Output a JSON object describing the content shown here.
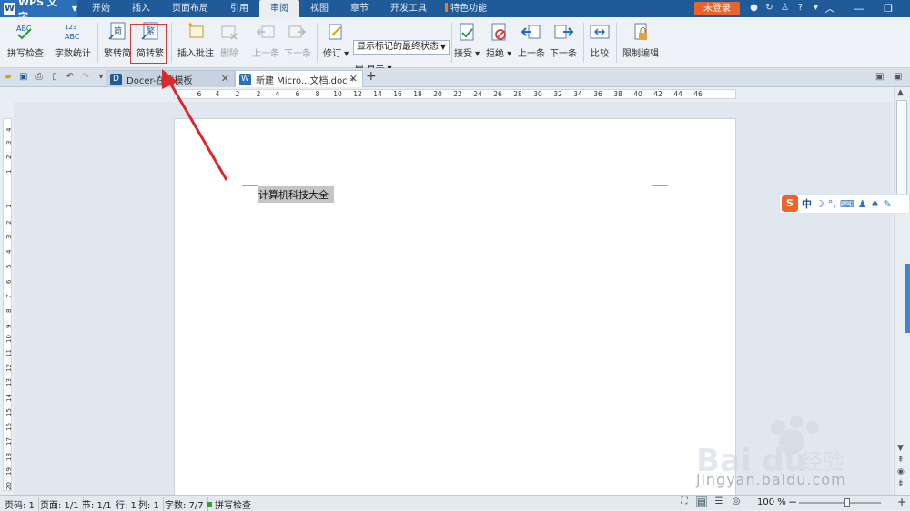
{
  "app": {
    "logo": "WPS 文字",
    "logo_letter": "W"
  },
  "menu": [
    "开始",
    "插入",
    "页面布局",
    "引用",
    "审阅",
    "视图",
    "章节",
    "开发工具",
    "特色功能"
  ],
  "menu_active_index": 4,
  "login_label": "未登录",
  "ribbon": {
    "spellcheck": "拼写检查",
    "wordcount": "字数统计",
    "trad_to_simp": "繁转简",
    "simp_to_trad": "简转繁",
    "insert_comment": "插入批注",
    "delete": "删除",
    "prev_comment": "上一条",
    "next_comment": "下一条",
    "track": "修订",
    "markup_state": "显示标记的最终状态",
    "show": "显示",
    "accept": "接受",
    "reject": "拒绝",
    "prev_change": "上一条",
    "next_change": "下一条",
    "compare": "比较",
    "restrict": "限制编辑",
    "icon_text_1": "ABC",
    "icon_text_2a": "123",
    "icon_text_2b": "ABC",
    "icon_text_3": "简",
    "icon_text_4": "繁"
  },
  "tabs": [
    {
      "label": "Docer-在线模板"
    },
    {
      "label": "新建 Micro...文档.doc *"
    }
  ],
  "ruler_h": [
    "6",
    "4",
    "2",
    "2",
    "4",
    "6",
    "8",
    "10",
    "12",
    "14",
    "16",
    "18",
    "20",
    "22",
    "24",
    "26",
    "28",
    "30",
    "32",
    "34",
    "36",
    "38",
    "40",
    "42",
    "44",
    "46"
  ],
  "ruler_v": [
    "4",
    "3",
    "2",
    "1",
    "1",
    "2",
    "3",
    "4",
    "5",
    "6",
    "7",
    "8",
    "9",
    "10",
    "11",
    "12",
    "13",
    "14",
    "15",
    "16",
    "17",
    "18",
    "19",
    "20"
  ],
  "document": {
    "selected_text": "计算机科技大全"
  },
  "ime": {
    "logo": "S",
    "mode": "中"
  },
  "status": {
    "page_code": "页码: 1",
    "pages": "页面: 1/1",
    "section": "节: 1/1",
    "row": "行: 1",
    "col": "列: 1",
    "words": "字数: 7/7",
    "spell": "拼写检查",
    "zoom": "100 %"
  },
  "watermark": {
    "text": "jingyan.baidu.com"
  }
}
